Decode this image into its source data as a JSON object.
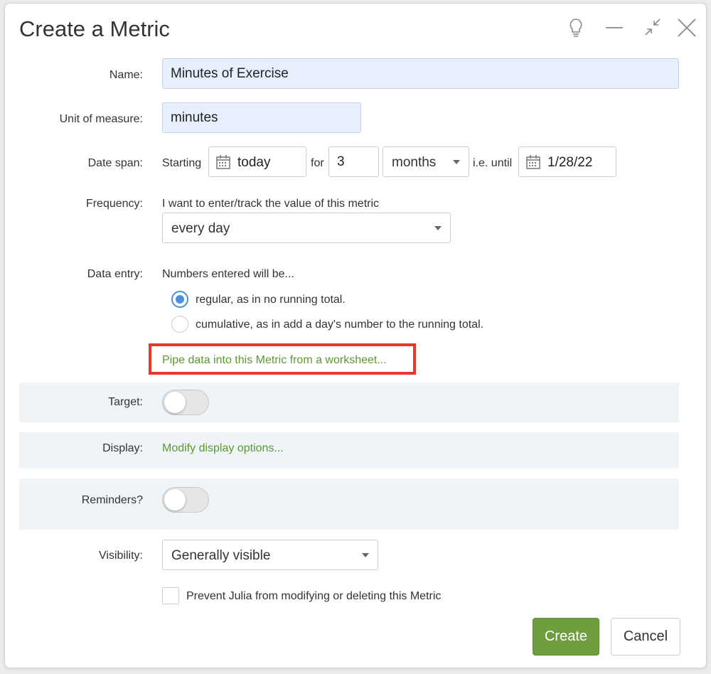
{
  "dialog": {
    "title": "Create a Metric",
    "window_icons": [
      "lightbulb-icon",
      "minimize-icon",
      "shrink-icon",
      "close-icon"
    ]
  },
  "form": {
    "name": {
      "label": "Name:",
      "value": "Minutes of Exercise"
    },
    "unit": {
      "label": "Unit of measure:",
      "value": "minutes"
    },
    "date_span": {
      "label": "Date span:",
      "starting_text": "Starting",
      "start_value": "today",
      "for_text": "for",
      "count_value": "3",
      "period_value": "months",
      "until_text": "i.e. until",
      "end_value": "1/28/22"
    },
    "frequency": {
      "label": "Frequency:",
      "description": "I want to enter/track the value of this metric",
      "value": "every day"
    },
    "data_entry": {
      "label": "Data entry:",
      "description": "Numbers entered will be...",
      "options": [
        {
          "label": "regular, as in no running total.",
          "checked": true
        },
        {
          "label": "cumulative, as in add a day's number to the running total.",
          "checked": false
        }
      ]
    },
    "pipe_link": "Pipe data into this Metric from a worksheet...",
    "target": {
      "label": "Target:",
      "enabled": false
    },
    "display": {
      "label": "Display:",
      "link": "Modify display options..."
    },
    "reminders": {
      "label": "Reminders?",
      "enabled": false
    },
    "visibility": {
      "label": "Visibility:",
      "value": "Generally visible"
    },
    "prevent": {
      "label": "Prevent Julia from modifying or deleting this Metric",
      "checked": false
    }
  },
  "buttons": {
    "create": "Create",
    "cancel": "Cancel"
  },
  "colors": {
    "accent_green": "#6e9e3e",
    "link_green": "#5a9a2a",
    "highlight_red": "#e8382a",
    "radio_blue": "#4a90d9",
    "input_fill": "#e7eefc",
    "band_bg": "#eff4f9"
  }
}
